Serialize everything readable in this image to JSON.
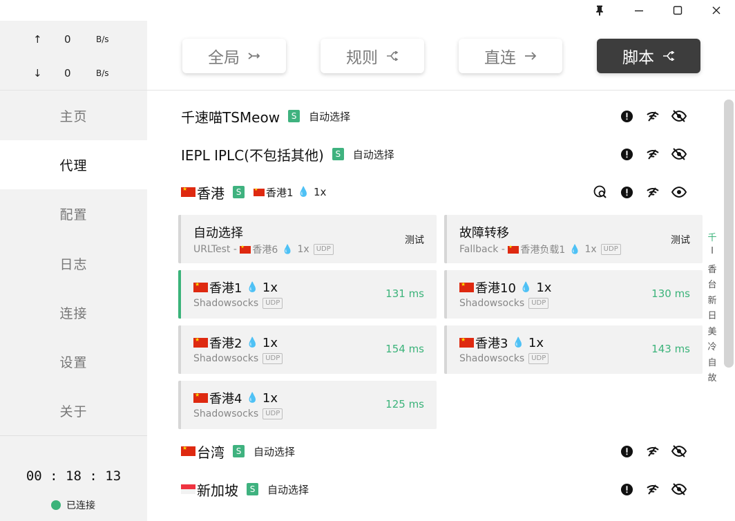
{
  "window": {
    "pin_icon": "pin-icon",
    "minimize_label": "—",
    "maximize_label": "☐",
    "close_label": "✕"
  },
  "speed": {
    "up_arrow": "↑",
    "up_value": "0",
    "up_unit": "B/s",
    "down_arrow": "↓",
    "down_value": "0",
    "down_unit": "B/s"
  },
  "nav": [
    {
      "label": "主页"
    },
    {
      "label": "代理"
    },
    {
      "label": "配置"
    },
    {
      "label": "日志"
    },
    {
      "label": "连接"
    },
    {
      "label": "设置"
    },
    {
      "label": "关于"
    }
  ],
  "status": {
    "timer": "00 : 18 : 13",
    "connection": "已连接"
  },
  "modes": [
    {
      "label": "全局",
      "icon": "↣"
    },
    {
      "label": "规则",
      "icon": "⪪"
    },
    {
      "label": "直连",
      "icon": "→"
    },
    {
      "label": "脚本",
      "icon": "⪪"
    }
  ],
  "groups": [
    {
      "name": "千速喵TSMeow",
      "badge": "S",
      "selected": "自动选择"
    },
    {
      "name": "IEPL IPLC(不包括其他)",
      "badge": "S",
      "selected": "自动选择"
    },
    {
      "name": "香港",
      "badge": "S",
      "selected": "香港1",
      "mult": "1x"
    },
    {
      "name": "台湾",
      "badge": "S",
      "selected": "自动选择"
    },
    {
      "name": "新加坡",
      "badge": "S",
      "selected": "自动选择"
    }
  ],
  "proxies": [
    {
      "name": "自动选择",
      "type": "URLTest",
      "sep": " - ",
      "sub": "香港6",
      "mult": "1x",
      "udp": "UDP",
      "action": "测试"
    },
    {
      "name": "故障转移",
      "type": "Fallback",
      "sep": " - ",
      "sub": "香港负载1",
      "mult": "1x",
      "udp": "UDP",
      "action": "测试"
    },
    {
      "name": "香港1",
      "mult": "1x",
      "type": "Shadowsocks",
      "udp": "UDP",
      "latency": "131 ms"
    },
    {
      "name": "香港10",
      "mult": "1x",
      "type": "Shadowsocks",
      "udp": "UDP",
      "latency": "130 ms"
    },
    {
      "name": "香港2",
      "mult": "1x",
      "type": "Shadowsocks",
      "udp": "UDP",
      "latency": "154 ms"
    },
    {
      "name": "香港3",
      "mult": "1x",
      "type": "Shadowsocks",
      "udp": "UDP",
      "latency": "143 ms"
    },
    {
      "name": "香港4",
      "mult": "1x",
      "type": "Shadowsocks",
      "udp": "UDP",
      "latency": "125 ms"
    }
  ],
  "index": [
    "千",
    "I",
    "香",
    "台",
    "新",
    "日",
    "美",
    "冷",
    "自",
    "故"
  ],
  "colors": {
    "accent": "#3bb37a",
    "badge": "#3fb27f",
    "active_mode": "#3d3d3d"
  }
}
